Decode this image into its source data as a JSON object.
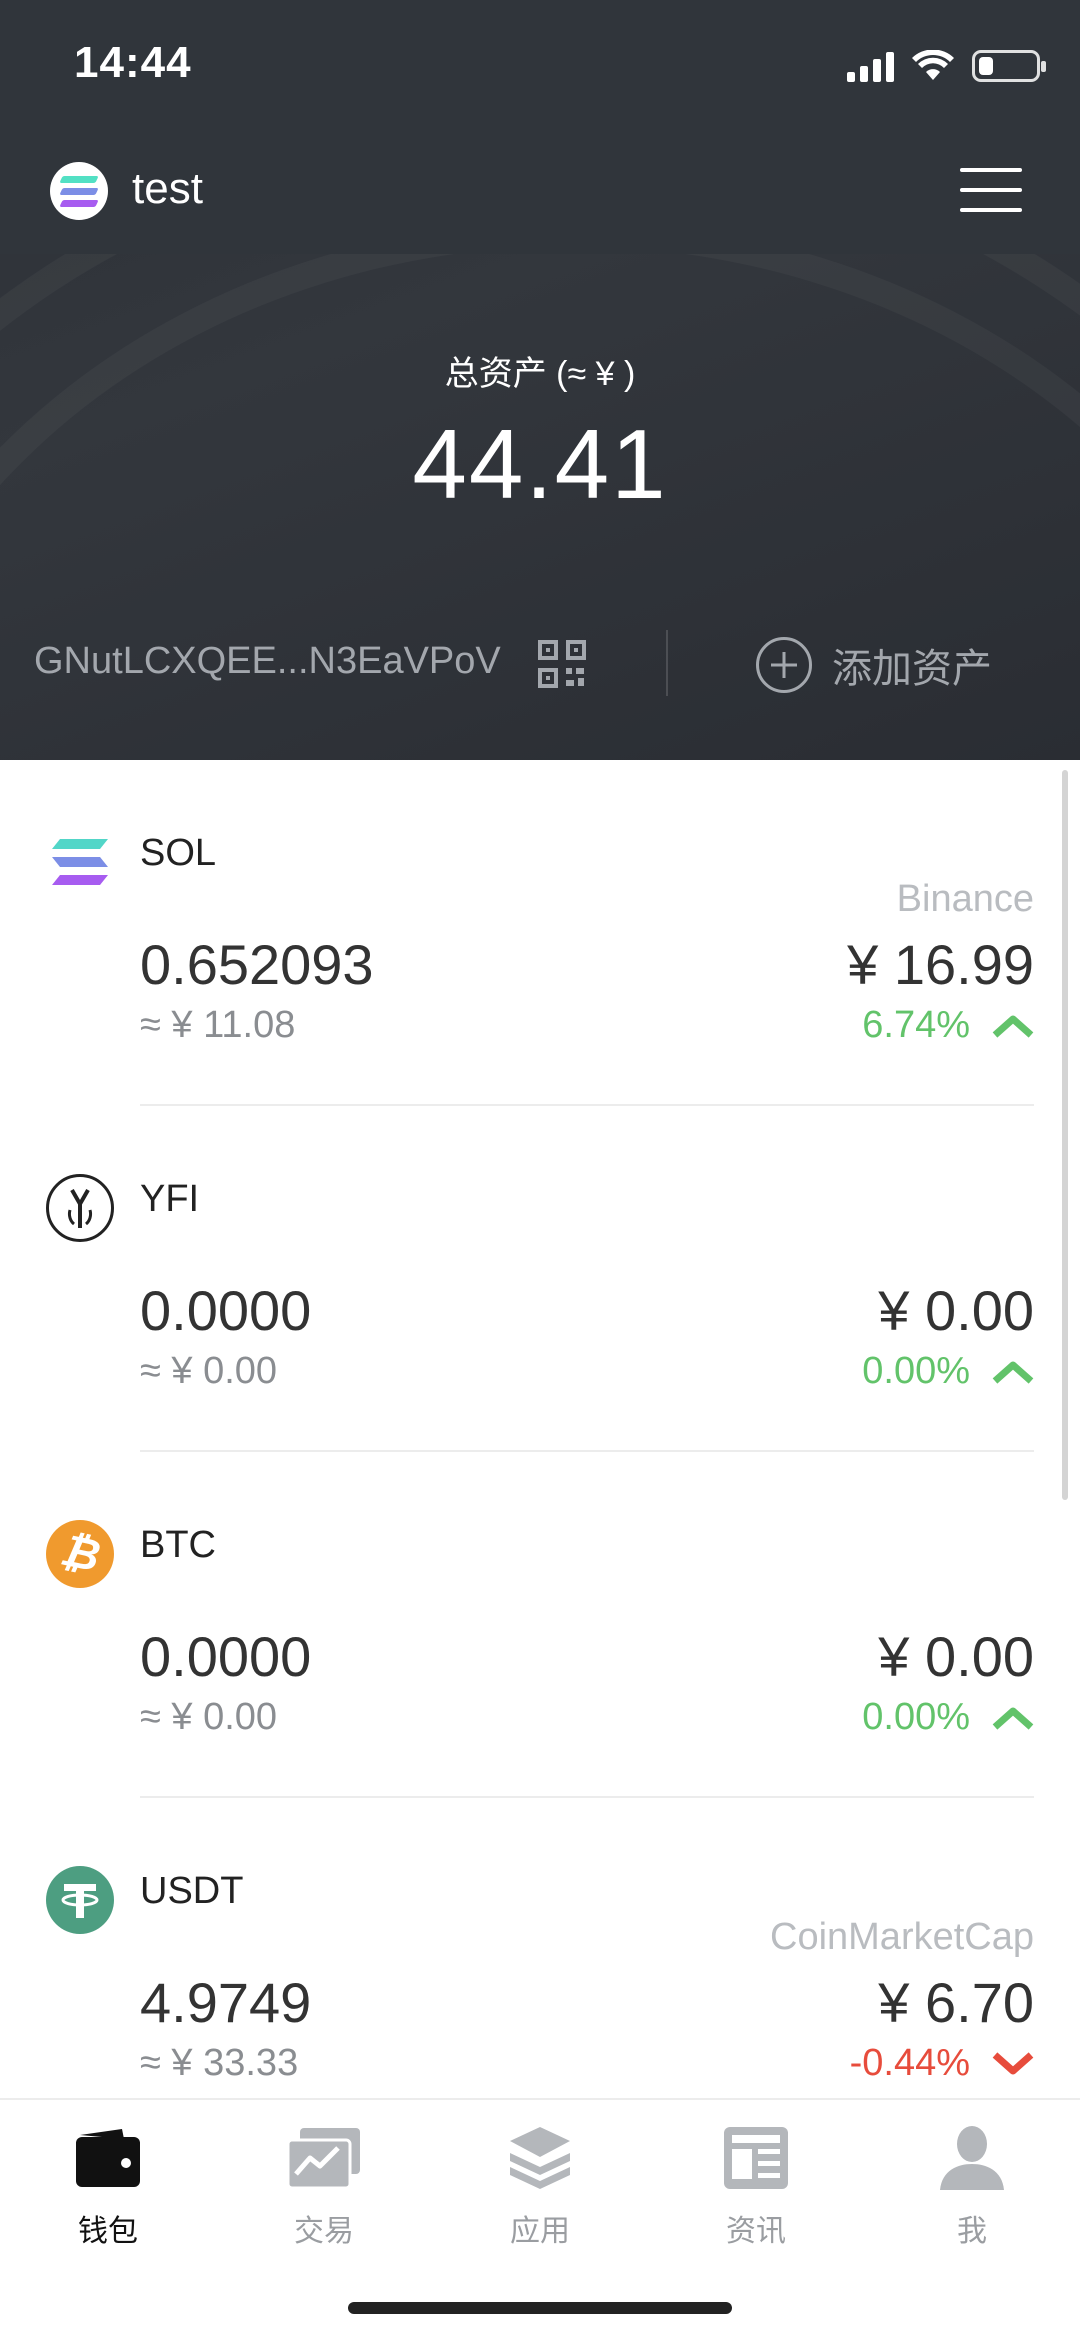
{
  "status_bar": {
    "time": "14:44",
    "battery_level": 0.25,
    "icons": [
      "signal-icon",
      "wifi-icon",
      "battery-icon"
    ]
  },
  "wallet": {
    "name": "test",
    "logo_icon": "solana-logo-icon",
    "menu_icon": "menu-icon"
  },
  "summary": {
    "total_label": "总资产 (≈ ¥ )",
    "total_value": "44.41",
    "address": "GNutLCXQEE...N3EaVPoV",
    "add_asset_label": "添加资产"
  },
  "assets": [
    {
      "symbol": "SOL",
      "source": "Binance",
      "amount": "0.652093",
      "value": "≈ ¥ 11.08",
      "price": "¥ 16.99",
      "change": "6.74%",
      "direction": "up",
      "icon": "sol-icon"
    },
    {
      "symbol": "YFI",
      "source": "",
      "amount": "0.0000",
      "value": "≈ ¥ 0.00",
      "price": "¥ 0.00",
      "change": "0.00%",
      "direction": "up",
      "icon": "yfi-icon"
    },
    {
      "symbol": "BTC",
      "source": "",
      "amount": "0.0000",
      "value": "≈ ¥ 0.00",
      "price": "¥ 0.00",
      "change": "0.00%",
      "direction": "up",
      "icon": "btc-icon"
    },
    {
      "symbol": "USDT",
      "source": "CoinMarketCap",
      "amount": "4.9749",
      "value": "≈ ¥ 33.33",
      "price": "¥ 6.70",
      "change": "-0.44%",
      "direction": "down",
      "icon": "usdt-icon"
    }
  ],
  "bottom_nav": [
    {
      "label": "钱包",
      "icon": "wallet-icon",
      "active": true
    },
    {
      "label": "交易",
      "icon": "trade-chart-icon",
      "active": false
    },
    {
      "label": "应用",
      "icon": "layers-icon",
      "active": false
    },
    {
      "label": "资讯",
      "icon": "news-icon",
      "active": false
    },
    {
      "label": "我",
      "icon": "profile-icon",
      "active": false
    }
  ],
  "colors": {
    "header_bg": "#30353b",
    "up": "#62c36a",
    "down": "#e74c3c",
    "btc": "#f09a2e",
    "usdt": "#4d9e81"
  }
}
